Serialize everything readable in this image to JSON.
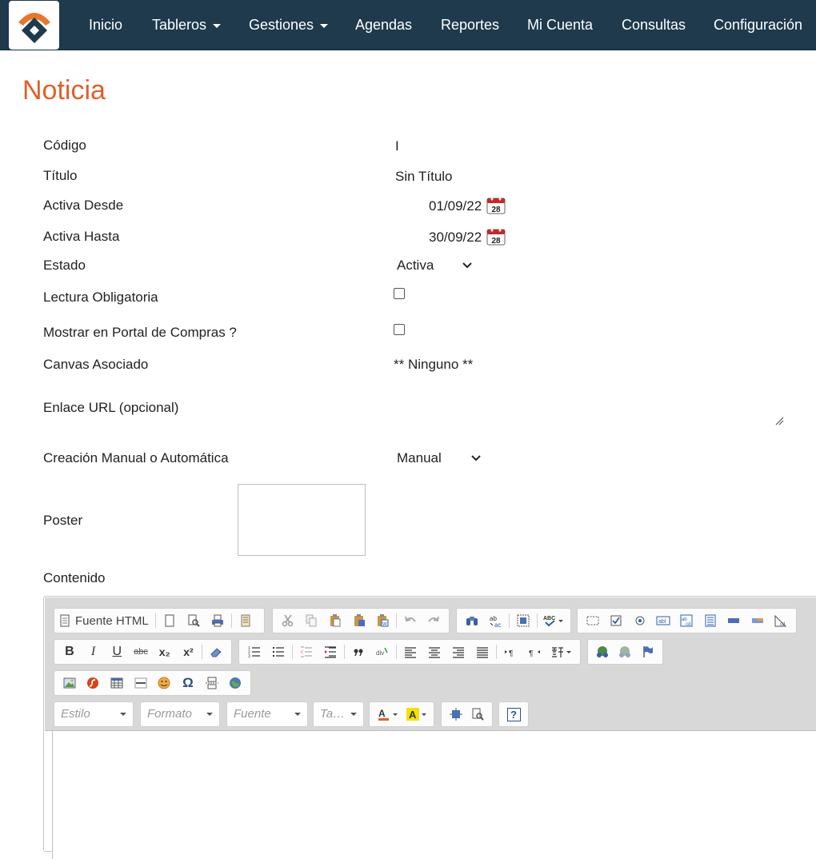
{
  "nav": {
    "items": [
      {
        "label": "Inicio",
        "dropdown": false
      },
      {
        "label": "Tableros",
        "dropdown": true
      },
      {
        "label": "Gestiones",
        "dropdown": true
      },
      {
        "label": "Agendas",
        "dropdown": false
      },
      {
        "label": "Reportes",
        "dropdown": false
      },
      {
        "label": "Mi Cuenta",
        "dropdown": false
      },
      {
        "label": "Consultas",
        "dropdown": false
      },
      {
        "label": "Configuración",
        "dropdown": false
      }
    ]
  },
  "page": {
    "title": "Noticia"
  },
  "form": {
    "codigo": {
      "label": "Código",
      "value": "I"
    },
    "titulo": {
      "label": "Título",
      "value": "Sin Título"
    },
    "activa_desde": {
      "label": "Activa Desde",
      "value": "01/09/22",
      "calendar_day": "28"
    },
    "activa_hasta": {
      "label": "Activa Hasta",
      "value": "30/09/22",
      "calendar_day": "28"
    },
    "estado": {
      "label": "Estado",
      "selected": "Activa"
    },
    "lectura_obligatoria": {
      "label": "Lectura Obligatoria",
      "checked": false
    },
    "mostrar_portal": {
      "label": "Mostrar en Portal de Compras ?",
      "checked": false
    },
    "canvas": {
      "label": "Canvas Asociado",
      "value": "** Ninguno **"
    },
    "enlace": {
      "label": "Enlace URL (opcional)",
      "value": ""
    },
    "creacion": {
      "label": "Creación Manual o Automática",
      "selected": "Manual"
    },
    "poster": {
      "label": "Poster"
    },
    "contenido": {
      "label": "Contenido"
    }
  },
  "editor": {
    "source_label": "Fuente HTML",
    "combos": {
      "style": "Estilo",
      "format": "Formato",
      "font": "Fuente",
      "size": "Ta…"
    },
    "glyphs": {
      "bold": "B",
      "italic": "I",
      "underline": "U",
      "strike": "abc",
      "sub": "x₂",
      "sup": "x²",
      "help": "?",
      "omega": "Ω"
    }
  },
  "colors": {
    "nav_bg": "#1e3a4c",
    "title": "#e0602a",
    "logo_orange": "#e8772e",
    "logo_navy": "#1e3a4c"
  }
}
